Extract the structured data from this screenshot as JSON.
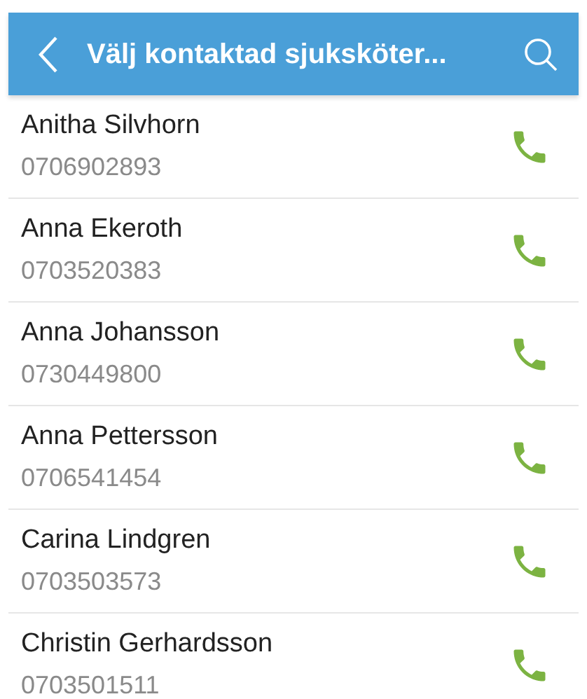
{
  "header": {
    "title": "Välj kontaktad sjuksköter..."
  },
  "contacts": [
    {
      "name": "Anitha Silvhorn",
      "phone": "0706902893"
    },
    {
      "name": "Anna Ekeroth",
      "phone": "0703520383"
    },
    {
      "name": "Anna Johansson",
      "phone": "0730449800"
    },
    {
      "name": "Anna Pettersson",
      "phone": "0706541454"
    },
    {
      "name": "Carina Lindgren",
      "phone": "0703503573"
    },
    {
      "name": "Christin Gerhardsson",
      "phone": "0703501511"
    }
  ]
}
